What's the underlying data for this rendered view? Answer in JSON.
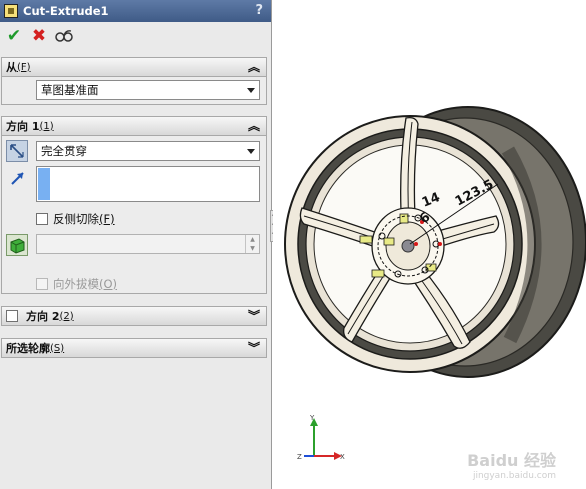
{
  "feature": {
    "title": "Cut-Extrude1",
    "help": "?"
  },
  "actions": {
    "ok": "✔",
    "cancel": "✖",
    "preview": "6o'"
  },
  "from": {
    "header": "从",
    "header_key": "(F)",
    "value": "草图基准面"
  },
  "direction1": {
    "header": "方向 1",
    "header_key": "(1)",
    "end_condition": "完全贯穿",
    "flip_side": {
      "label": "反侧切除",
      "key": "(F)",
      "checked": false
    },
    "draft": {
      "label": "向外拔模",
      "key": "(O)",
      "checked": false,
      "enabled": false
    }
  },
  "direction2": {
    "header": "方向 2",
    "header_key": "(2)",
    "checked": false
  },
  "contours": {
    "header": "所选轮廓",
    "header_key": "(S)"
  },
  "dimensions": {
    "d1": "14",
    "d2": "123.5",
    "d3": "6"
  },
  "triad": {
    "x": "X",
    "y": "Y",
    "z": "Z"
  },
  "watermark": {
    "line1": "Baidu 经验",
    "line2": "jingyan.baidu.com"
  }
}
